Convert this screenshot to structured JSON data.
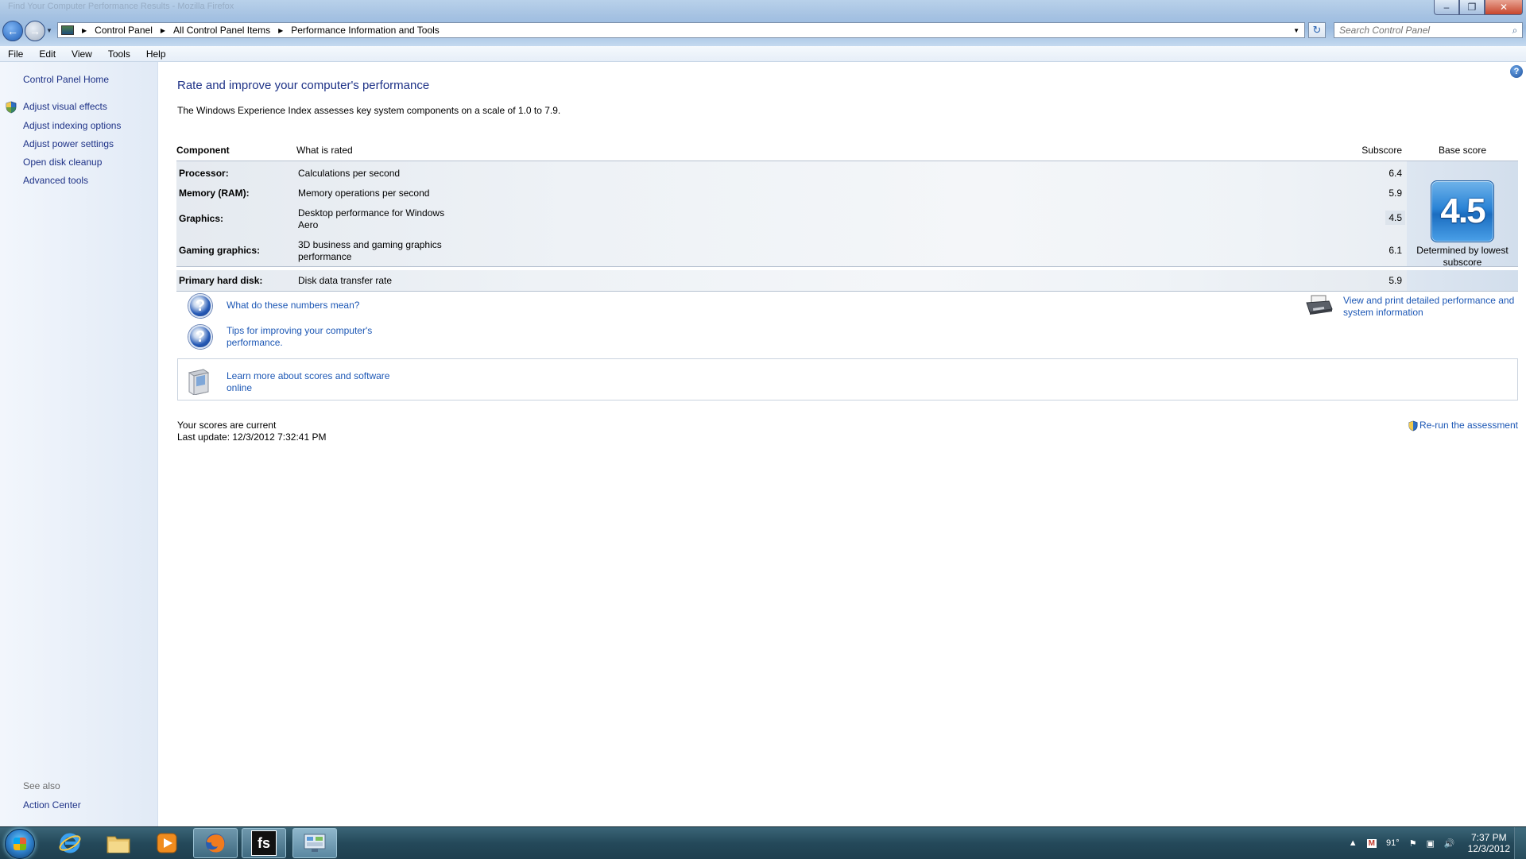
{
  "window": {
    "title": "Find Your Computer Performance Results - Mozilla Firefox",
    "caption_buttons": [
      "–",
      "❐",
      "✕"
    ]
  },
  "address_bar": {
    "breadcrumbs": [
      "Control Panel",
      "All Control Panel Items",
      "Performance Information and Tools"
    ]
  },
  "search": {
    "placeholder": "Search Control Panel"
  },
  "menu": [
    "File",
    "Edit",
    "View",
    "Tools",
    "Help"
  ],
  "left_pane": {
    "home": "Control Panel Home",
    "tasks": [
      "Adjust visual effects",
      "Adjust indexing options",
      "Adjust power settings",
      "Open disk cleanup",
      "Advanced tools"
    ],
    "see_also_label": "See also",
    "see_also": [
      "Action Center"
    ]
  },
  "main": {
    "title": "Rate and improve your computer's performance",
    "intro": "The Windows Experience Index assesses key system components on a scale of 1.0 to 7.9.",
    "table": {
      "headers": {
        "component": "Component",
        "what": "What is rated",
        "subscore": "Subscore",
        "base": "Base score"
      },
      "rows": [
        {
          "component": "Processor:",
          "what": "Calculations per second",
          "subscore": "6.4"
        },
        {
          "component": "Memory (RAM):",
          "what": "Memory operations per second",
          "subscore": "5.9"
        },
        {
          "component": "Graphics:",
          "what": "Desktop performance for Windows Aero",
          "subscore": "4.5"
        },
        {
          "component": "Gaming graphics:",
          "what": "3D business and gaming graphics performance",
          "subscore": "6.1"
        },
        {
          "component": "Primary hard disk:",
          "what": "Disk data transfer rate",
          "subscore": "5.9"
        }
      ],
      "base_score": "4.5",
      "base_caption": "Determined by lowest subscore"
    },
    "links": {
      "numbers": "What do these numbers mean?",
      "tips": "Tips for improving your computer's performance.",
      "print": "View and print detailed performance and system information",
      "learn": "Learn more about scores and software online"
    },
    "status": {
      "current": "Your scores are current",
      "last_update": "Last update: 12/3/2012 7:32:41 PM"
    },
    "rerun": "Re-run the assessment"
  },
  "taskbar": {
    "weather": "91°",
    "time": "7:37 PM",
    "date": "12/3/2012"
  },
  "colors": {
    "link": "#1c57b5",
    "title": "#1e3287",
    "taskbar": "#24495a"
  },
  "icons": [
    "back-arrow-icon",
    "forward-arrow-icon",
    "refresh-icon",
    "search-icon",
    "shield-icon",
    "help-icon",
    "question-icon",
    "printer-icon",
    "software-box-icon",
    "windows-start-icon",
    "ie-icon",
    "explorer-folder-icon",
    "media-player-icon",
    "firefox-icon",
    "fs-icon",
    "control-panel-icon",
    "gmail-icon",
    "flag-icon",
    "network-icon",
    "volume-icon"
  ]
}
